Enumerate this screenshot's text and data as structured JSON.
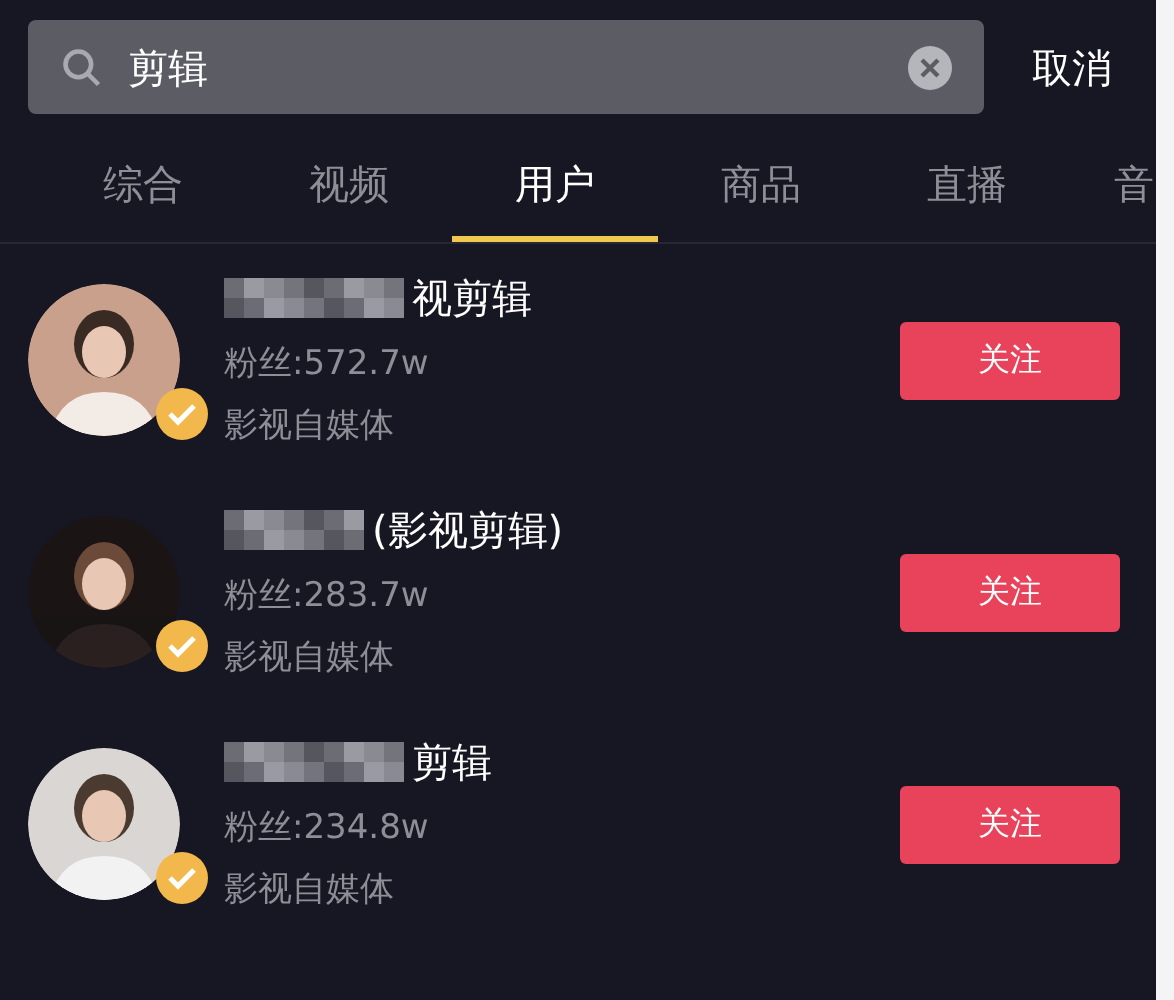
{
  "search": {
    "value": "剪辑",
    "cancel": "取消"
  },
  "tabs": [
    {
      "label": "综合",
      "selected": false
    },
    {
      "label": "视频",
      "selected": false
    },
    {
      "label": "用户",
      "selected": true
    },
    {
      "label": "商品",
      "selected": false
    },
    {
      "label": "直播",
      "selected": false
    },
    {
      "label": "音",
      "selected": false
    }
  ],
  "users": [
    {
      "name": "视剪辑",
      "fans": "粉丝:572.7w",
      "category": "影视自媒体",
      "verified": true,
      "follow": "关注"
    },
    {
      "name": "(影视剪辑)",
      "fans": "粉丝:283.7w",
      "category": "影视自媒体",
      "verified": true,
      "follow": "关注"
    },
    {
      "name": "剪辑",
      "fans": "粉丝:234.8w",
      "category": "影视自媒体",
      "verified": true,
      "follow": "关注"
    }
  ]
}
